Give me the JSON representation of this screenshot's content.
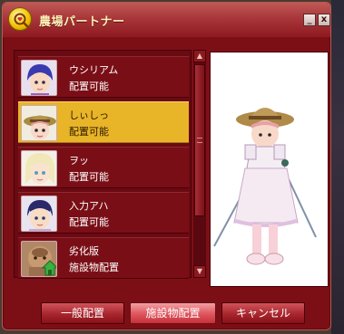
{
  "window": {
    "title": "農場パートナー",
    "minimize_label": "_",
    "close_label": "x"
  },
  "partners": [
    {
      "name": "ウシリアム",
      "status": "配置可能",
      "selected": false
    },
    {
      "name": "しぃしっ",
      "status": "配置可能",
      "selected": true
    },
    {
      "name": "ヲッ",
      "status": "配置可能",
      "selected": false
    },
    {
      "name": "入力アハ",
      "status": "配置可能",
      "selected": false
    },
    {
      "name": "劣化版",
      "status": "施設物配置",
      "selected": false
    }
  ],
  "buttons": {
    "general_placement": "一般配置",
    "facility_placement": "施設物配置",
    "cancel": "キャンセル"
  },
  "colors": {
    "window_bg": "#7c0f16",
    "selected_item": "#e8b428",
    "title_text": "#fff2b8"
  },
  "icons": {
    "title": "search-heart-icon",
    "facility": "house-icon"
  }
}
